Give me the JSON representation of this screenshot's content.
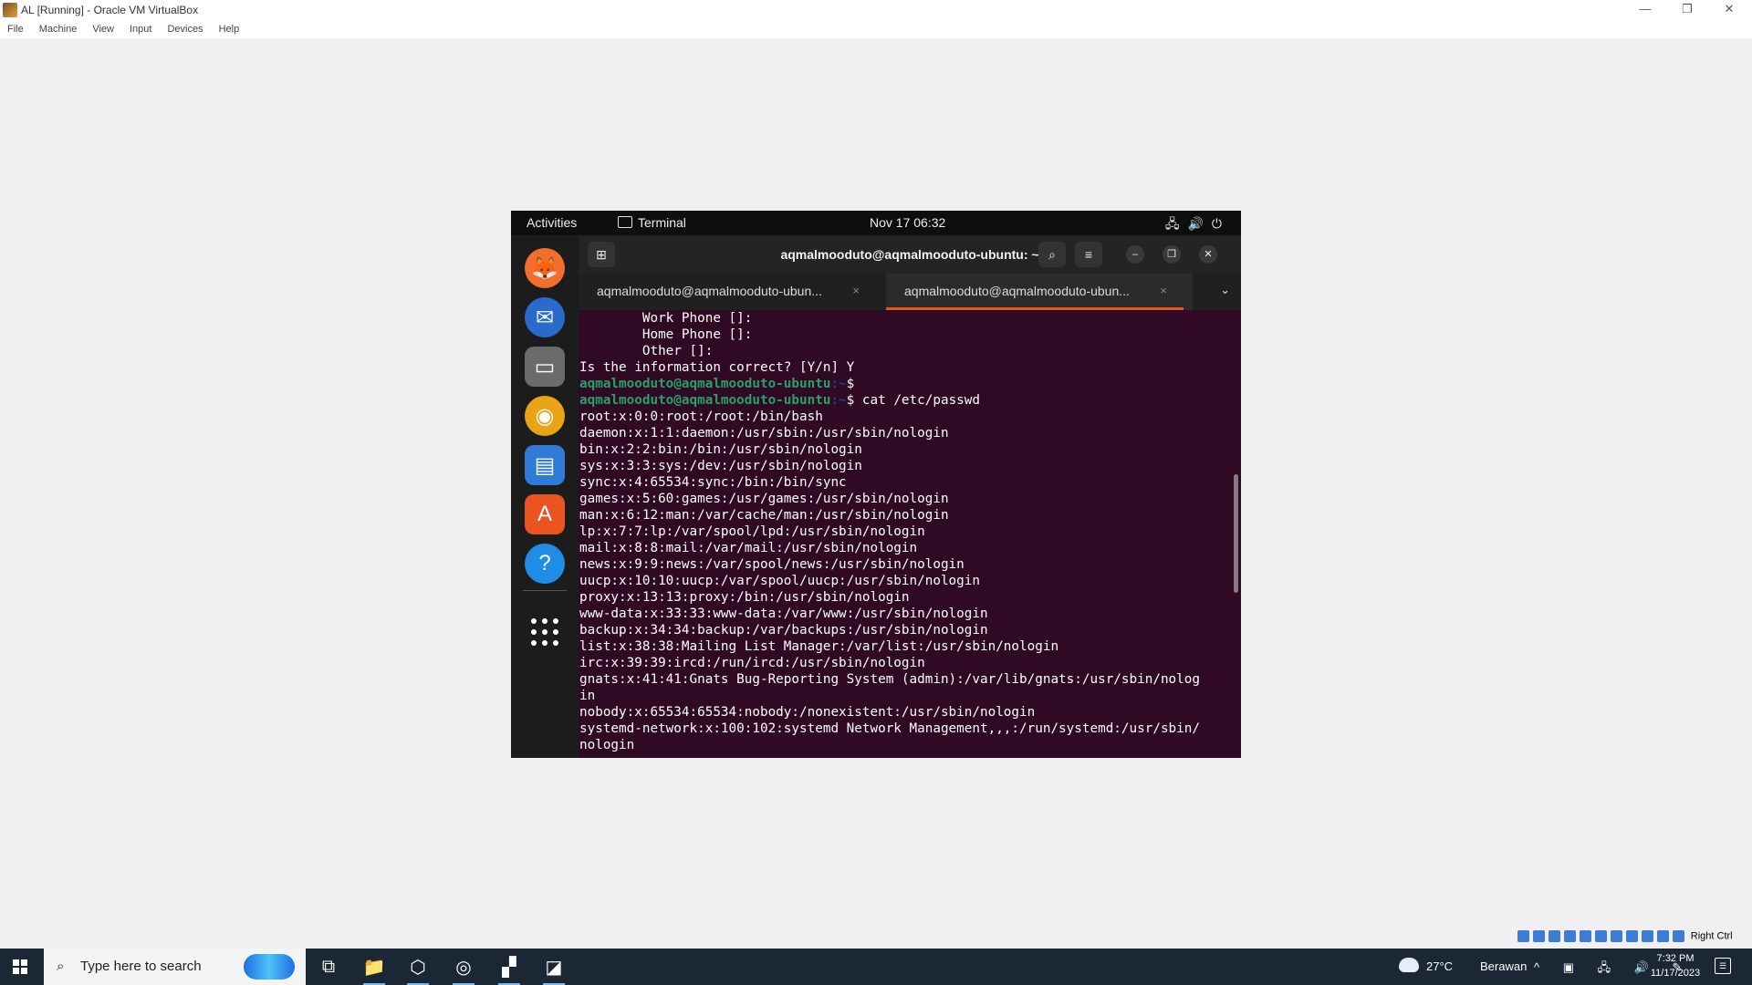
{
  "window": {
    "title": "AL [Running] - Oracle VM VirtualBox",
    "minimize": "—",
    "restore": "❐",
    "close": "✕",
    "menu": [
      "File",
      "Machine",
      "View",
      "Input",
      "Devices",
      "Help"
    ]
  },
  "gnome_topbar": {
    "activities": "Activities",
    "app_name": "Terminal",
    "clock": "Nov 17  06:32",
    "system_icons": "🖧🔊⏻"
  },
  "dock": {
    "apps": [
      {
        "name": "firefox",
        "glyph": "🦊",
        "color": "#f36d2c"
      },
      {
        "name": "thunderbird",
        "glyph": "✉",
        "color": "#2a6acb"
      },
      {
        "name": "files",
        "glyph": "▭",
        "color": "#6b6b6b"
      },
      {
        "name": "rhythmbox",
        "glyph": "◉",
        "color": "#e8a317"
      },
      {
        "name": "writer",
        "glyph": "▤",
        "color": "#2f7bd5"
      },
      {
        "name": "software",
        "glyph": "A",
        "color": "#e95420"
      },
      {
        "name": "help",
        "glyph": "?",
        "color": "#1f8ce6"
      }
    ]
  },
  "terminal": {
    "title": "aqmalmooduto@aqmalmooduto-ubuntu: ~",
    "newtab_glyph": "⊞",
    "search_glyph": "⌕",
    "menu_glyph": "≡",
    "min_glyph": "–",
    "max_glyph": "❐",
    "close_glyph": "✕",
    "tabs": [
      {
        "label": "aqmalmooduto@aqmalmooduto-ubun...",
        "close": "×"
      },
      {
        "label": "aqmalmooduto@aqmalmooduto-ubun...",
        "close": "×"
      }
    ],
    "tab_overflow": "⌄",
    "lines": [
      {
        "text": "        Work Phone []:"
      },
      {
        "text": "        Home Phone []:"
      },
      {
        "text": "        Other []:"
      },
      {
        "text": "Is the information correct? [Y/n] Y"
      },
      {
        "user": "aqmalmooduto@aqmalmooduto-ubuntu",
        "path": ":~",
        "cmd": "$ "
      },
      {
        "user": "aqmalmooduto@aqmalmooduto-ubuntu",
        "path": ":~",
        "cmd": "$ cat /etc/passwd"
      },
      {
        "text": "root:x:0:0:root:/root:/bin/bash"
      },
      {
        "text": "daemon:x:1:1:daemon:/usr/sbin:/usr/sbin/nologin"
      },
      {
        "text": "bin:x:2:2:bin:/bin:/usr/sbin/nologin"
      },
      {
        "text": "sys:x:3:3:sys:/dev:/usr/sbin/nologin"
      },
      {
        "text": "sync:x:4:65534:sync:/bin:/bin/sync"
      },
      {
        "text": "games:x:5:60:games:/usr/games:/usr/sbin/nologin"
      },
      {
        "text": "man:x:6:12:man:/var/cache/man:/usr/sbin/nologin"
      },
      {
        "text": "lp:x:7:7:lp:/var/spool/lpd:/usr/sbin/nologin"
      },
      {
        "text": "mail:x:8:8:mail:/var/mail:/usr/sbin/nologin"
      },
      {
        "text": "news:x:9:9:news:/var/spool/news:/usr/sbin/nologin"
      },
      {
        "text": "uucp:x:10:10:uucp:/var/spool/uucp:/usr/sbin/nologin"
      },
      {
        "text": "proxy:x:13:13:proxy:/bin:/usr/sbin/nologin"
      },
      {
        "text": "www-data:x:33:33:www-data:/var/www:/usr/sbin/nologin"
      },
      {
        "text": "backup:x:34:34:backup:/var/backups:/usr/sbin/nologin"
      },
      {
        "text": "list:x:38:38:Mailing List Manager:/var/list:/usr/sbin/nologin"
      },
      {
        "text": "irc:x:39:39:ircd:/run/ircd:/usr/sbin/nologin"
      },
      {
        "text": "gnats:x:41:41:Gnats Bug-Reporting System (admin):/var/lib/gnats:/usr/sbin/nolog"
      },
      {
        "text": "in"
      },
      {
        "text": "nobody:x:65534:65534:nobody:/nonexistent:/usr/sbin/nologin"
      },
      {
        "text": "systemd-network:x:100:102:systemd Network Management,,,:/run/systemd:/usr/sbin/"
      },
      {
        "text": "nologin"
      }
    ]
  },
  "vbox_status": {
    "host_key": "Right Ctrl"
  },
  "taskbar": {
    "search_placeholder": "Type here to search",
    "search_glyph": "⌕",
    "apps": [
      {
        "name": "task-view",
        "glyph": "⧉"
      },
      {
        "name": "file-explorer",
        "glyph": "📁"
      },
      {
        "name": "virtualbox",
        "glyph": "⬡"
      },
      {
        "name": "chrome",
        "glyph": "◎"
      },
      {
        "name": "app-5",
        "glyph": "▞"
      },
      {
        "name": "app-6",
        "glyph": "◪"
      }
    ],
    "weather_temp": "27°C",
    "weather_desc": "Berawan",
    "tray_icons": "^ ▣ 🖧 🔊 ✎",
    "time": "7:32 PM",
    "date": "11/17/2023",
    "notif_glyph": "☰"
  }
}
